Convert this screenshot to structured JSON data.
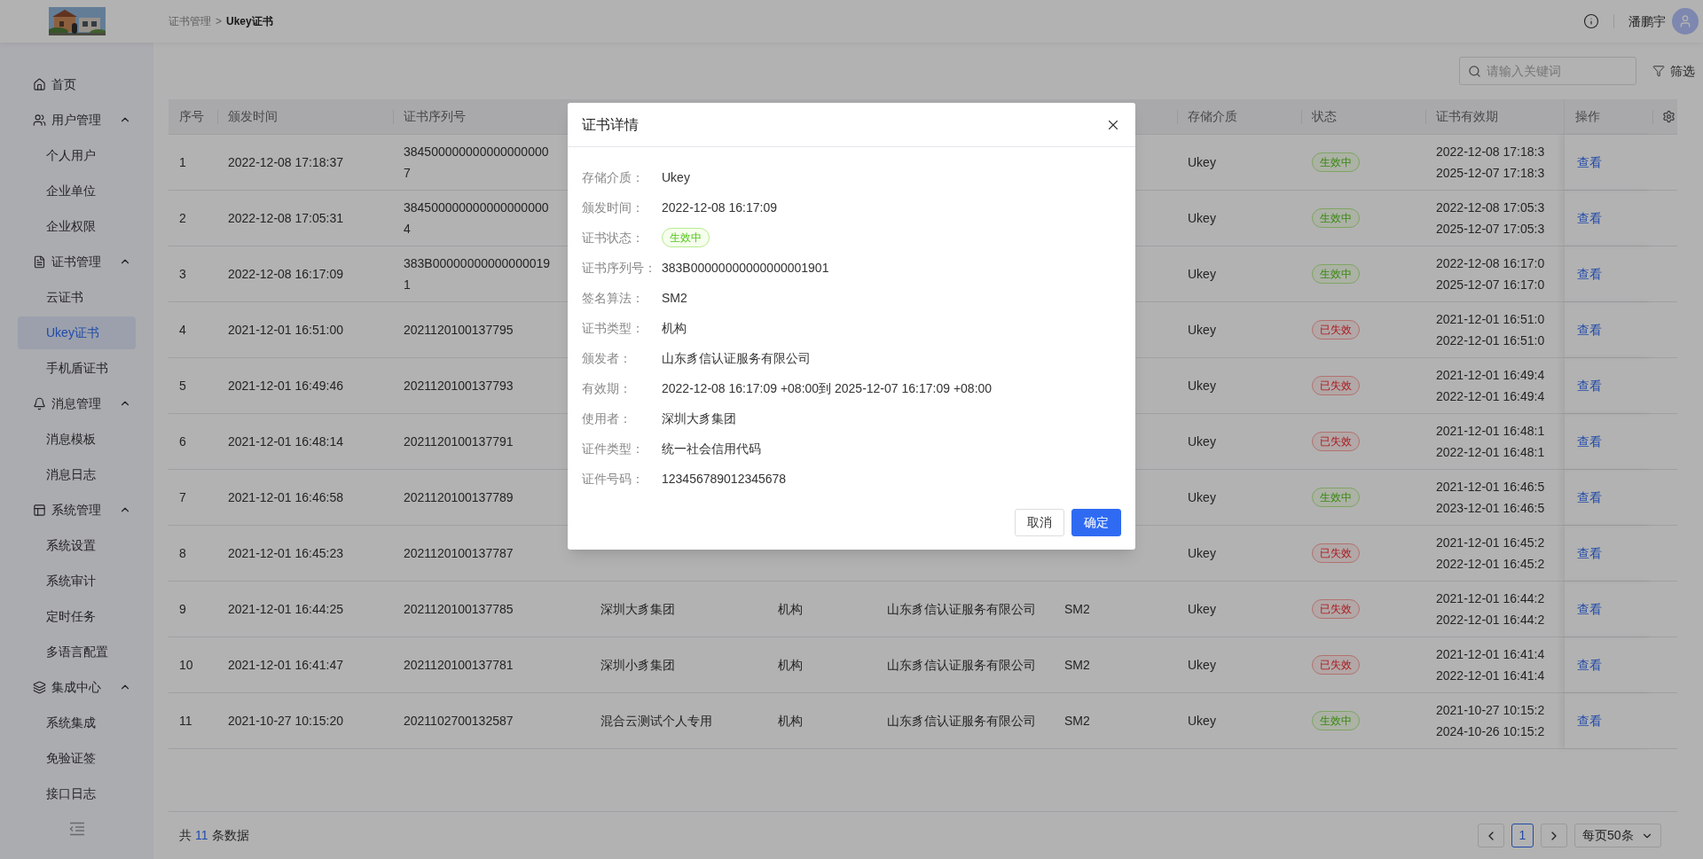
{
  "header": {
    "breadcrumb": [
      "证书管理",
      "Ukey证书"
    ],
    "breadcrumb_separator": ">",
    "user_name": "潘鹏宇"
  },
  "sidebar": {
    "items": [
      {
        "label": "首页",
        "selected": false
      },
      {
        "label": "用户管理",
        "expanded": true,
        "children": [
          {
            "label": "个人用户",
            "selected": false
          },
          {
            "label": "企业单位",
            "selected": false
          },
          {
            "label": "企业权限",
            "selected": false
          }
        ]
      },
      {
        "label": "证书管理",
        "expanded": true,
        "children": [
          {
            "label": "云证书",
            "selected": false
          },
          {
            "label": "Ukey证书",
            "selected": true
          },
          {
            "label": "手机盾证书",
            "selected": false
          }
        ]
      },
      {
        "label": "消息管理",
        "expanded": true,
        "children": [
          {
            "label": "消息模板",
            "selected": false
          },
          {
            "label": "消息日志",
            "selected": false
          }
        ]
      },
      {
        "label": "系统管理",
        "expanded": true,
        "children": [
          {
            "label": "系统设置",
            "selected": false
          },
          {
            "label": "系统审计",
            "selected": false
          },
          {
            "label": "定时任务",
            "selected": false
          },
          {
            "label": "多语言配置",
            "selected": false
          }
        ]
      },
      {
        "label": "集成中心",
        "expanded": true,
        "children": [
          {
            "label": "系统集成",
            "selected": false
          },
          {
            "label": "免验证签",
            "selected": false
          },
          {
            "label": "接口日志",
            "selected": false
          }
        ]
      }
    ]
  },
  "toolbar": {
    "search": {
      "placeholder": "请输入关键词"
    },
    "filter": "筛选"
  },
  "table": {
    "columns": [
      "序号",
      "颁发时间",
      "证书序列号",
      "存储介质",
      "状态",
      "证书有效期",
      "操作"
    ],
    "rows": [
      {
        "index": "1",
        "issued": "2022-12-08 17:18:37",
        "serial": [
          "384500000000000000000",
          "7"
        ],
        "storage": "Ukey",
        "status": {
          "label": "生效中",
          "kind": "active"
        },
        "validity": [
          "2022-12-08 17:18:3",
          "2025-12-07 17:18:3"
        ],
        "action": "查看"
      },
      {
        "index": "2",
        "issued": "2022-12-08 17:05:31",
        "serial": [
          "384500000000000000000",
          "4"
        ],
        "storage": "Ukey",
        "status": {
          "label": "生效中",
          "kind": "active"
        },
        "validity": [
          "2022-12-08 17:05:3",
          "2025-12-07 17:05:3"
        ],
        "action": "查看"
      },
      {
        "index": "3",
        "issued": "2022-12-08 16:17:09",
        "serial": [
          "383B00000000000000019",
          "1"
        ],
        "storage": "Ukey",
        "status": {
          "label": "生效中",
          "kind": "active"
        },
        "validity": [
          "2022-12-08 16:17:0",
          "2025-12-07 16:17:0"
        ],
        "action": "查看"
      },
      {
        "index": "4",
        "issued": "2021-12-01 16:51:00",
        "serial": [
          "2021120100137795"
        ],
        "storage": "Ukey",
        "status": {
          "label": "已失效",
          "kind": "expired"
        },
        "validity": [
          "2021-12-01 16:51:0",
          "2022-12-01 16:51:0"
        ],
        "action": "查看"
      },
      {
        "index": "5",
        "issued": "2021-12-01 16:49:46",
        "serial": [
          "2021120100137793"
        ],
        "storage": "Ukey",
        "status": {
          "label": "已失效",
          "kind": "expired"
        },
        "validity": [
          "2021-12-01 16:49:4",
          "2022-12-01 16:49:4"
        ],
        "action": "查看"
      },
      {
        "index": "6",
        "issued": "2021-12-01 16:48:14",
        "serial": [
          "2021120100137791"
        ],
        "storage": "Ukey",
        "status": {
          "label": "已失效",
          "kind": "expired"
        },
        "validity": [
          "2021-12-01 16:48:1",
          "2022-12-01 16:48:1"
        ],
        "action": "查看"
      },
      {
        "index": "7",
        "issued": "2021-12-01 16:46:58",
        "serial": [
          "2021120100137789"
        ],
        "storage": "Ukey",
        "status": {
          "label": "生效中",
          "kind": "active"
        },
        "validity": [
          "2021-12-01 16:46:5",
          "2023-12-01 16:46:5"
        ],
        "action": "查看"
      },
      {
        "index": "8",
        "issued": "2021-12-01 16:45:23",
        "serial": [
          "2021120100137787"
        ],
        "storage": "Ukey",
        "status": {
          "label": "已失效",
          "kind": "expired"
        },
        "validity": [
          "2021-12-01 16:45:2",
          "2022-12-01 16:45:2"
        ],
        "action": "查看"
      },
      {
        "index": "9",
        "issued": "2021-12-01 16:44:25",
        "serial": [
          "2021120100137785"
        ],
        "holder": "深圳大豸集团",
        "cert_type": "机构",
        "issuer": "山东豸信认证服务有限公司",
        "algorithm": "SM2",
        "storage": "Ukey",
        "status": {
          "label": "已失效",
          "kind": "expired"
        },
        "validity": [
          "2021-12-01 16:44:2",
          "2022-12-01 16:44:2"
        ],
        "action": "查看"
      },
      {
        "index": "10",
        "issued": "2021-12-01 16:41:47",
        "serial": [
          "2021120100137781"
        ],
        "holder": "深圳小豸集团",
        "cert_type": "机构",
        "issuer": "山东豸信认证服务有限公司",
        "algorithm": "SM2",
        "storage": "Ukey",
        "status": {
          "label": "已失效",
          "kind": "expired"
        },
        "validity": [
          "2021-12-01 16:41:4",
          "2022-12-01 16:41:4"
        ],
        "action": "查看"
      },
      {
        "index": "11",
        "issued": "2021-10-27 10:15:20",
        "serial": [
          "2021102700132587"
        ],
        "holder": "混合云测试个人专用",
        "cert_type": "机构",
        "issuer": "山东豸信认证服务有限公司",
        "algorithm": "SM2",
        "storage": "Ukey",
        "status": {
          "label": "生效中",
          "kind": "active"
        },
        "validity": [
          "2021-10-27 10:15:2",
          "2024-10-26 10:15:2"
        ],
        "action": "查看"
      }
    ]
  },
  "pagination": {
    "total_prefix": "共",
    "total": "11",
    "total_suffix": "条数据",
    "pages": [
      {
        "label": "1",
        "selected": true
      }
    ],
    "page_size": "每页50条"
  },
  "dialog": {
    "title": "证书详情",
    "fields": [
      {
        "kind": "text",
        "label": "存储介质：",
        "value": "Ukey"
      },
      {
        "kind": "text",
        "label": "颁发时间：",
        "value": "2022-12-08 16:17:09"
      },
      {
        "kind": "badge",
        "label": "证书状态：",
        "value": "生效中"
      },
      {
        "kind": "text",
        "label": "证书序列号：",
        "value": "383B00000000000000001901"
      },
      {
        "kind": "text",
        "label": "签名算法：",
        "value": "SM2"
      },
      {
        "kind": "text",
        "label": "证书类型：",
        "value": "机构"
      },
      {
        "kind": "text",
        "label": "颁发者：",
        "value": "山东豸信认证服务有限公司"
      },
      {
        "kind": "text",
        "label": "有效期：",
        "value": "2022-12-08 16:17:09 +08:00到 2025-12-07 16:17:09 +08:00"
      },
      {
        "kind": "text",
        "label": "使用者：",
        "value": "深圳大豸集团"
      },
      {
        "kind": "text",
        "label": "证件类型：",
        "value": "统一社会信用代码"
      },
      {
        "kind": "text",
        "label": "证件号码：",
        "value": "123456789012345678"
      }
    ],
    "buttons": [
      {
        "label": "取消",
        "kind": "default"
      },
      {
        "label": "确定",
        "kind": "primary"
      }
    ]
  }
}
